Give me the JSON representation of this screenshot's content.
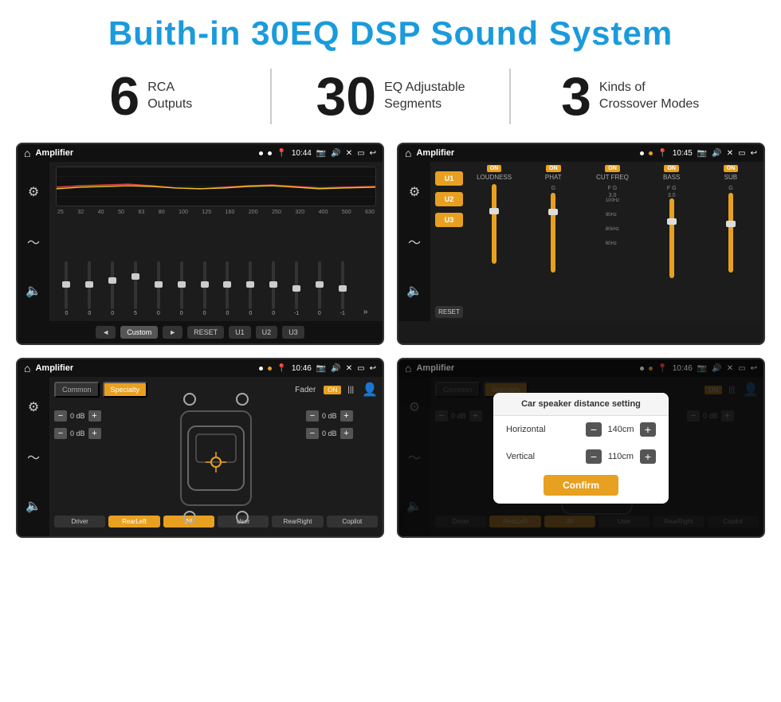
{
  "header": {
    "title": "Buith-in 30EQ DSP Sound System"
  },
  "stats": [
    {
      "number": "6",
      "label": "RCA\nOutputs"
    },
    {
      "number": "30",
      "label": "EQ Adjustable\nSegments"
    },
    {
      "number": "3",
      "label": "Kinds of\nCrossover Modes"
    }
  ],
  "screen1": {
    "status_bar": {
      "title": "Amplifier",
      "time": "10:44"
    },
    "freq_labels": [
      "25",
      "32",
      "40",
      "50",
      "63",
      "80",
      "100",
      "125",
      "160",
      "200",
      "250",
      "320",
      "400",
      "500",
      "630"
    ],
    "slider_values": [
      "0",
      "0",
      "0",
      "5",
      "0",
      "0",
      "0",
      "0",
      "0",
      "0",
      "-1",
      "0",
      "-1"
    ],
    "buttons": [
      "◄",
      "Custom",
      "►",
      "RESET",
      "U1",
      "U2",
      "U3"
    ]
  },
  "screen2": {
    "status_bar": {
      "title": "Amplifier",
      "time": "10:45"
    },
    "u_buttons": [
      "U1",
      "U2",
      "U3"
    ],
    "channels": [
      {
        "on": true,
        "label": "LOUDNESS"
      },
      {
        "on": true,
        "label": "PHAT"
      },
      {
        "on": true,
        "label": "CUT FREQ"
      },
      {
        "on": true,
        "label": "BASS"
      },
      {
        "on": true,
        "label": "SUB"
      }
    ],
    "reset_label": "RESET"
  },
  "screen3": {
    "status_bar": {
      "title": "Amplifier",
      "time": "10:46"
    },
    "tabs": [
      "Common",
      "Specialty"
    ],
    "fader_label": "Fader",
    "fader_on": "ON",
    "db_values": [
      "0 dB",
      "0 dB",
      "0 dB",
      "0 dB"
    ],
    "bottom_buttons": [
      "Driver",
      "RearLeft",
      "All",
      "User",
      "RearRight",
      "Copilot"
    ]
  },
  "screen4": {
    "status_bar": {
      "title": "Amplifier",
      "time": "10:46"
    },
    "tabs": [
      "Common",
      "Specialty"
    ],
    "dialog": {
      "title": "Car speaker distance setting",
      "horizontal_label": "Horizontal",
      "horizontal_value": "140cm",
      "vertical_label": "Vertical",
      "vertical_value": "110cm",
      "confirm_label": "Confirm"
    },
    "db_values": [
      "0 dB",
      "0 dB"
    ],
    "bottom_buttons": [
      "Driver",
      "RearLeft",
      "All",
      "User",
      "RearRight",
      "Copilot"
    ]
  }
}
